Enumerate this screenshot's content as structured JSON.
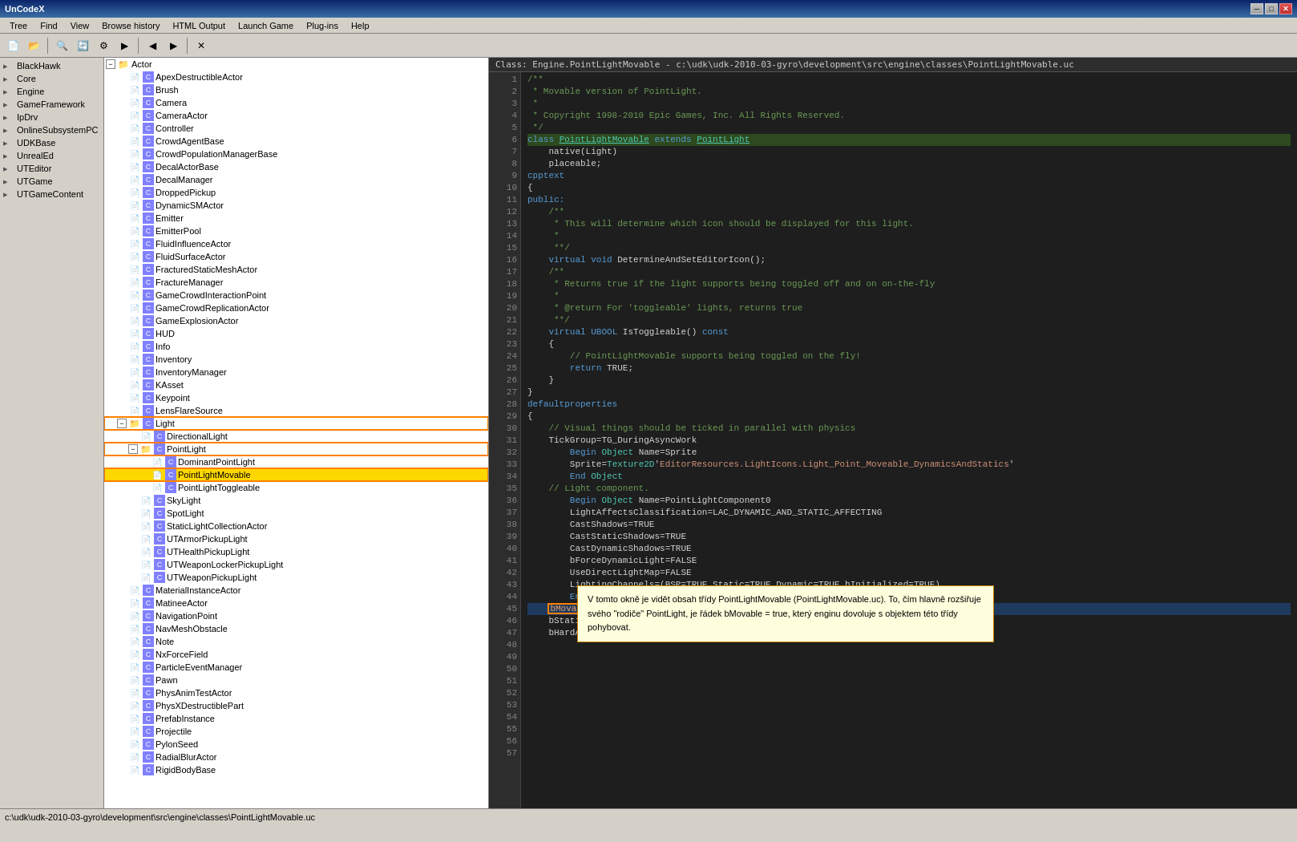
{
  "window": {
    "title": "UnCodeX",
    "subtitle": "UnCodeX"
  },
  "menu": {
    "items": [
      "Tree",
      "Find",
      "View",
      "Browse history",
      "HTML Output",
      "Launch Game",
      "Plug-ins",
      "Help"
    ]
  },
  "class_header": "Class: Engine.PointLightMovable - c:\\udk\\udk-2010-03-gyro\\development\\src\\engine\\classes\\PointLightMovable.uc",
  "left_panel": {
    "items": [
      {
        "label": "BlackHawk",
        "level": 0,
        "icon": "folder"
      },
      {
        "label": "Core",
        "level": 0,
        "icon": "folder"
      },
      {
        "label": "Engine",
        "level": 0,
        "icon": "folder"
      },
      {
        "label": "GameFramework",
        "level": 0,
        "icon": "folder"
      },
      {
        "label": "IpDrv",
        "level": 0,
        "icon": "folder"
      },
      {
        "label": "OnlineSubsystemPC",
        "level": 0,
        "icon": "folder"
      },
      {
        "label": "UDKBase",
        "level": 0,
        "icon": "folder"
      },
      {
        "label": "UnrealEd",
        "level": 0,
        "icon": "folder"
      },
      {
        "label": "UTEditor",
        "level": 0,
        "icon": "folder"
      },
      {
        "label": "UTGame",
        "level": 0,
        "icon": "folder"
      },
      {
        "label": "UTGameContent",
        "level": 0,
        "icon": "folder"
      }
    ]
  },
  "middle_panel": {
    "root": "Actor",
    "items": [
      {
        "label": "Actor",
        "level": 0,
        "expanded": true,
        "type": "root"
      },
      {
        "label": "ApexDestructibleActor",
        "level": 1,
        "type": "leaf"
      },
      {
        "label": "Brush",
        "level": 1,
        "type": "leaf"
      },
      {
        "label": "Camera",
        "level": 1,
        "type": "leaf"
      },
      {
        "label": "CameraActor",
        "level": 1,
        "type": "leaf"
      },
      {
        "label": "Controller",
        "level": 1,
        "type": "leaf"
      },
      {
        "label": "CrowdAgentBase",
        "level": 1,
        "type": "leaf"
      },
      {
        "label": "CrowdPopulationManagerBase",
        "level": 1,
        "type": "leaf"
      },
      {
        "label": "DecalActorBase",
        "level": 1,
        "type": "leaf"
      },
      {
        "label": "DecalManager",
        "level": 1,
        "type": "leaf"
      },
      {
        "label": "DroppedPickup",
        "level": 1,
        "type": "leaf"
      },
      {
        "label": "DynamicSMActor",
        "level": 1,
        "type": "leaf"
      },
      {
        "label": "Emitter",
        "level": 1,
        "type": "leaf"
      },
      {
        "label": "EmitterPool",
        "level": 1,
        "type": "leaf"
      },
      {
        "label": "FluidInfluenceActor",
        "level": 1,
        "type": "leaf"
      },
      {
        "label": "FluidSurfaceActor",
        "level": 1,
        "type": "leaf"
      },
      {
        "label": "FracturedStaticMeshActor",
        "level": 1,
        "type": "leaf"
      },
      {
        "label": "FractureManager",
        "level": 1,
        "type": "leaf"
      },
      {
        "label": "GameCrowdInteractionPoint",
        "level": 1,
        "type": "leaf"
      },
      {
        "label": "GameCrowdReplicationActor",
        "level": 1,
        "type": "leaf"
      },
      {
        "label": "GameExplosionActor",
        "level": 1,
        "type": "leaf"
      },
      {
        "label": "HUD",
        "level": 1,
        "type": "leaf"
      },
      {
        "label": "Info",
        "level": 1,
        "type": "leaf"
      },
      {
        "label": "Inventory",
        "level": 1,
        "type": "leaf"
      },
      {
        "label": "InventoryManager",
        "level": 1,
        "type": "leaf"
      },
      {
        "label": "KAsset",
        "level": 1,
        "type": "leaf"
      },
      {
        "label": "Keypoint",
        "level": 1,
        "type": "leaf"
      },
      {
        "label": "LensFlareSource",
        "level": 1,
        "type": "leaf"
      },
      {
        "label": "Light",
        "level": 1,
        "expanded": true,
        "type": "parent",
        "outlined": true
      },
      {
        "label": "DirectionalLight",
        "level": 2,
        "type": "leaf"
      },
      {
        "label": "PointLight",
        "level": 2,
        "expanded": true,
        "type": "parent",
        "outlined": true
      },
      {
        "label": "DominantPointLight",
        "level": 3,
        "type": "leaf"
      },
      {
        "label": "PointLightMovable",
        "level": 3,
        "type": "leaf",
        "selected": true
      },
      {
        "label": "PointLightToggleable",
        "level": 3,
        "type": "leaf"
      },
      {
        "label": "SkyLight",
        "level": 2,
        "type": "leaf"
      },
      {
        "label": "SpotLight",
        "level": 2,
        "type": "leaf"
      },
      {
        "label": "StaticLightCollectionActor",
        "level": 2,
        "type": "leaf"
      },
      {
        "label": "UTArmorPickupLight",
        "level": 2,
        "type": "leaf"
      },
      {
        "label": "UTHealthPickupLight",
        "level": 2,
        "type": "leaf"
      },
      {
        "label": "UTWeaponLockerPickupLight",
        "level": 2,
        "type": "leaf"
      },
      {
        "label": "UTWeaponPickupLight",
        "level": 2,
        "type": "leaf"
      },
      {
        "label": "MaterialInstanceActor",
        "level": 1,
        "type": "leaf"
      },
      {
        "label": "MatineeActor",
        "level": 1,
        "type": "leaf"
      },
      {
        "label": "NavigationPoint",
        "level": 1,
        "type": "leaf"
      },
      {
        "label": "NavMeshObstacle",
        "level": 1,
        "type": "leaf"
      },
      {
        "label": "Note",
        "level": 1,
        "type": "leaf"
      },
      {
        "label": "NxForceField",
        "level": 1,
        "type": "leaf"
      },
      {
        "label": "ParticleEventManager",
        "level": 1,
        "type": "leaf"
      },
      {
        "label": "Pawn",
        "level": 1,
        "type": "leaf"
      },
      {
        "label": "PhysAnimTestActor",
        "level": 1,
        "type": "leaf"
      },
      {
        "label": "PhysXDestructiblePart",
        "level": 1,
        "type": "leaf"
      },
      {
        "label": "PrefabInstance",
        "level": 1,
        "type": "leaf"
      },
      {
        "label": "Projectile",
        "level": 1,
        "type": "leaf"
      },
      {
        "label": "PylonSeed",
        "level": 1,
        "type": "leaf"
      },
      {
        "label": "RadialBlurActor",
        "level": 1,
        "type": "leaf"
      },
      {
        "label": "RigidBodyBase",
        "level": 1,
        "type": "leaf"
      }
    ]
  },
  "code": {
    "filename": "PointLightMovable.uc",
    "lines": [
      {
        "n": 1,
        "text": "/**",
        "type": "comment"
      },
      {
        "n": 2,
        "text": " * Movable version of PointLight.",
        "type": "comment"
      },
      {
        "n": 3,
        "text": " *",
        "type": "comment"
      },
      {
        "n": 4,
        "text": " * Copyright 1998-2010 Epic Games, Inc. All Rights Reserved.",
        "type": "comment"
      },
      {
        "n": 5,
        "text": " */",
        "type": "comment"
      },
      {
        "n": 6,
        "text": "class PointLightMovable extends PointLight",
        "type": "highlight"
      },
      {
        "n": 7,
        "text": "    native(Light)",
        "type": "normal"
      },
      {
        "n": 8,
        "text": "    placeable;",
        "type": "normal"
      },
      {
        "n": 9,
        "text": "",
        "type": "normal"
      },
      {
        "n": 10,
        "text": "cpptext",
        "type": "normal"
      },
      {
        "n": 11,
        "text": "{",
        "type": "normal"
      },
      {
        "n": 12,
        "text": "public:",
        "type": "normal"
      },
      {
        "n": 13,
        "text": "    /**",
        "type": "comment"
      },
      {
        "n": 14,
        "text": "     * This will determine which icon should be displayed for this light.",
        "type": "comment"
      },
      {
        "n": 15,
        "text": "     *",
        "type": "comment"
      },
      {
        "n": 16,
        "text": "     **/",
        "type": "comment"
      },
      {
        "n": 17,
        "text": "    virtual void DetermineAndSetEditorIcon();",
        "type": "normal"
      },
      {
        "n": 18,
        "text": "",
        "type": "normal"
      },
      {
        "n": 19,
        "text": "    /**",
        "type": "comment"
      },
      {
        "n": 20,
        "text": "     * Returns true if the light supports being toggled off and on on-the-fly",
        "type": "comment"
      },
      {
        "n": 21,
        "text": "     *",
        "type": "comment"
      },
      {
        "n": 22,
        "text": "     * @return For 'toggleable' lights, returns true",
        "type": "comment"
      },
      {
        "n": 23,
        "text": "     **/",
        "type": "comment"
      },
      {
        "n": 24,
        "text": "    virtual UBOOL IsToggleable() const",
        "type": "normal"
      },
      {
        "n": 25,
        "text": "    {",
        "type": "normal"
      },
      {
        "n": 26,
        "text": "        // PointLightMovable supports being toggled on the fly!",
        "type": "comment"
      },
      {
        "n": 27,
        "text": "        return TRUE;",
        "type": "normal"
      },
      {
        "n": 28,
        "text": "    }",
        "type": "normal"
      },
      {
        "n": 29,
        "text": "}",
        "type": "normal"
      },
      {
        "n": 30,
        "text": "",
        "type": "normal"
      },
      {
        "n": 31,
        "text": "",
        "type": "normal"
      },
      {
        "n": 32,
        "text": "defaultproperties",
        "type": "normal"
      },
      {
        "n": 33,
        "text": "{",
        "type": "normal"
      },
      {
        "n": 34,
        "text": "    // Visual things should be ticked in parallel with physics",
        "type": "comment"
      },
      {
        "n": 35,
        "text": "    TickGroup=TG_DuringAsyncWork",
        "type": "normal"
      },
      {
        "n": 36,
        "text": "",
        "type": "normal"
      },
      {
        "n": 37,
        "text": "    Begin Object Name=Sprite",
        "type": "normal"
      },
      {
        "n": 38,
        "text": "        Sprite=Texture2D'EditorResources.LightIcons.Light_Point_Moveable_DynamicsAndStatics'",
        "type": "normal"
      },
      {
        "n": 39,
        "text": "    End Object",
        "type": "normal"
      },
      {
        "n": 40,
        "text": "",
        "type": "normal"
      },
      {
        "n": 41,
        "text": "    // Light component.",
        "type": "comment"
      },
      {
        "n": 42,
        "text": "    Begin Object Name=PointLightComponent0",
        "type": "normal"
      },
      {
        "n": 43,
        "text": "        LightAffectsClassification=LAC_DYNAMIC_AND_STATIC_AFFECTING",
        "type": "normal"
      },
      {
        "n": 44,
        "text": "",
        "type": "normal"
      },
      {
        "n": 45,
        "text": "        CastShadows=TRUE",
        "type": "normal"
      },
      {
        "n": 46,
        "text": "        CastStaticShadows=TRUE",
        "type": "normal"
      },
      {
        "n": 47,
        "text": "        CastDynamicShadows=TRUE",
        "type": "normal"
      },
      {
        "n": 48,
        "text": "        bForceDynamicLight=FALSE",
        "type": "normal"
      },
      {
        "n": 49,
        "text": "        UseDirectLightMap=FALSE",
        "type": "normal"
      },
      {
        "n": 50,
        "text": "",
        "type": "normal"
      },
      {
        "n": 51,
        "text": "        LightingChannels=(BSP=TRUE,Static=TRUE,Dynamic=TRUE,bInitialized=TRUE)",
        "type": "normal"
      },
      {
        "n": 52,
        "text": "    End Object",
        "type": "normal"
      },
      {
        "n": 53,
        "text": "",
        "type": "normal"
      },
      {
        "n": 54,
        "text": "    bMovable=TRUE",
        "type": "highlight2"
      },
      {
        "n": 55,
        "text": "    bStatic=FALSE",
        "type": "normal"
      },
      {
        "n": 56,
        "text": "    bHardAttach=TRUE",
        "type": "normal"
      },
      {
        "n": 57,
        "text": "",
        "type": "normal"
      }
    ]
  },
  "annotation": {
    "text": "V tomto okně je vidět obsah třídy PointLightMovable (PointLightMovable.uc).\nTo, čím hlavně rozšiřuje svého \"rodiče\" PointLight, je řádek bMovable = true,\nkterý enginu dovoluje s objektem této třídy pohybovat."
  },
  "status_bar": {
    "path": "c:\\udk\\udk-2010-03-gyro\\development\\src\\engine\\classes\\PointLightMovable.uc"
  }
}
